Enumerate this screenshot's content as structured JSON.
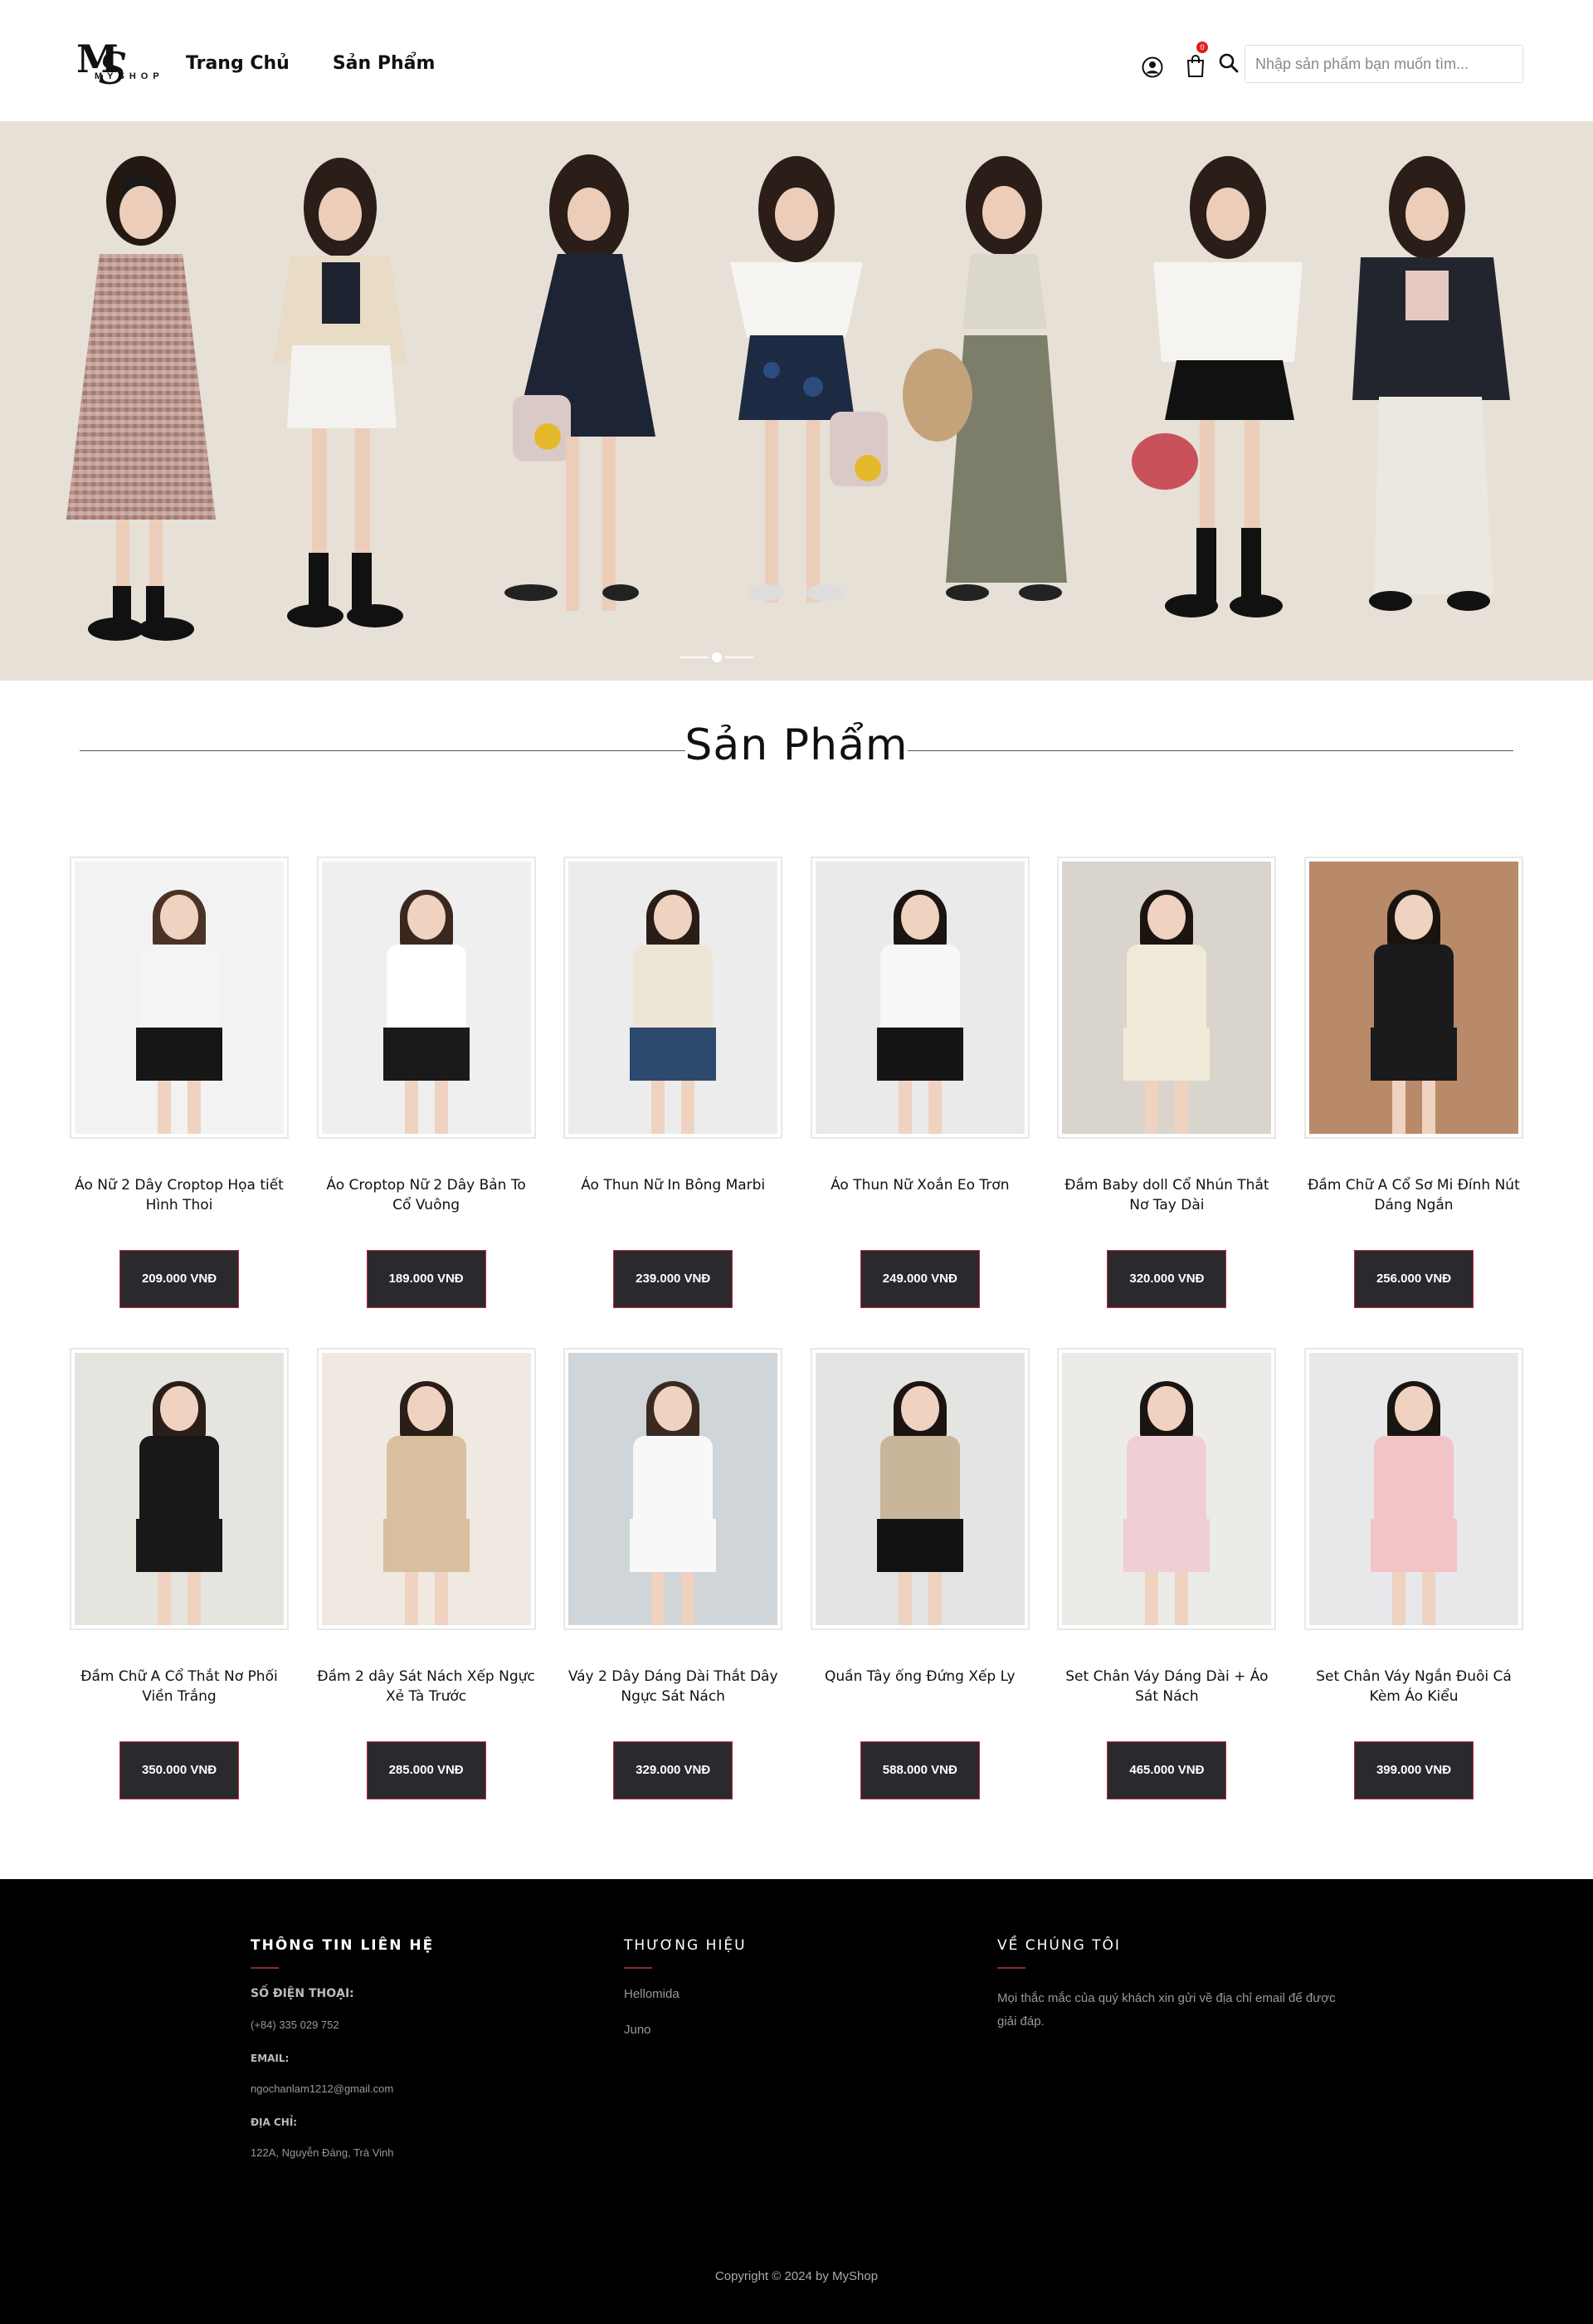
{
  "header": {
    "logo_mark": "MS",
    "logo_sub": "MYSHOP",
    "nav": [
      "Trang Chủ",
      "Sản Phẩm"
    ],
    "cart_count": "0",
    "search_placeholder": "Nhập sản phẩm bạn muốn tìm..."
  },
  "hero": {
    "slide_index": 2,
    "slide_count": 3
  },
  "section": {
    "title": "Sản Phẩm"
  },
  "products": [
    {
      "name": "Áo Nữ 2 Dây Croptop Họa tiết Hình Thoi",
      "price": "209.000 VNĐ"
    },
    {
      "name": "Áo Croptop Nữ 2 Dây Bản To Cổ Vuông",
      "price": "189.000 VNĐ"
    },
    {
      "name": "Áo Thun Nữ In Bông Marbi",
      "price": "239.000 VNĐ"
    },
    {
      "name": "Áo Thun Nữ Xoắn Eo Trơn",
      "price": "249.000 VNĐ"
    },
    {
      "name": "Đầm Baby doll Cổ Nhún Thắt Nơ Tay Dài",
      "price": "320.000 VNĐ"
    },
    {
      "name": "Đầm Chữ A Cổ Sơ Mi Đính Nút Dáng Ngắn",
      "price": "256.000 VNĐ"
    },
    {
      "name": "Đầm Chữ A Cổ Thắt Nơ Phối Viền Trắng",
      "price": "350.000 VNĐ"
    },
    {
      "name": "Đầm 2 dây Sát Nách Xếp Ngực Xẻ Tà Trước",
      "price": "285.000 VNĐ"
    },
    {
      "name": "Váy 2 Dây Dáng Dài Thắt Dây Ngực Sát Nách",
      "price": "329.000 VNĐ"
    },
    {
      "name": "Quần Tây ống Đứng Xếp Ly",
      "price": "588.000 VNĐ"
    },
    {
      "name": "Set Chân Váy Dáng Dài + Áo Sát Nách",
      "price": "465.000 VNĐ"
    },
    {
      "name": "Set Chân Váy Ngắn Đuôi Cá Kèm Áo Kiểu",
      "price": "399.000 VNĐ"
    }
  ],
  "footer": {
    "contact": {
      "heading": "THÔNG TIN LIÊN HỆ",
      "phone_label": "SỐ ĐIỆN THOẠI:",
      "phone": "(+84) 335 029 752",
      "email_label": "EMAIL:",
      "email": "ngochanlam1212@gmail.com",
      "address_label": "ĐỊA CHỈ:",
      "address": "122A, Nguyễn Đáng, Trà Vinh"
    },
    "brands": {
      "heading": "THƯƠNG HIỆU",
      "items": [
        "Hellomida",
        "Juno"
      ]
    },
    "about": {
      "heading": "VỀ CHÚNG TÔI",
      "text": "Mọi thắc mắc của quý khách xin gửi về địa chỉ email để được giải đáp."
    },
    "copyright": "Copyright © 2024 by MyShop"
  }
}
